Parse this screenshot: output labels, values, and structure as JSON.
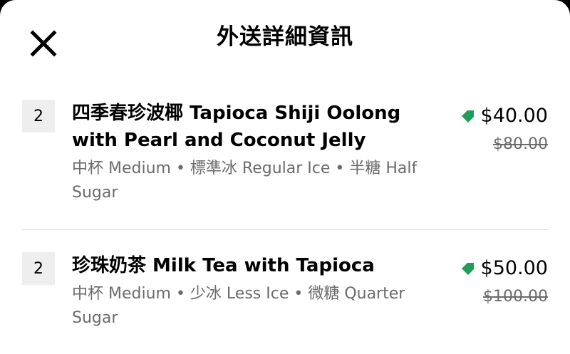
{
  "header": {
    "title": "外送詳細資訊",
    "close_icon": "close-icon"
  },
  "items": [
    {
      "quantity": "2",
      "name": "四季春珍波椰 Tapioca Shiji Oolong with Pearl and Coconut Jelly",
      "options": "中杯 Medium • 標準冰 Regular Ice • 半糖 Half Sugar",
      "price": "$40.00",
      "original_price": "$80.00",
      "promo_icon": "promo-tag-icon"
    },
    {
      "quantity": "2",
      "name": "珍珠奶茶 Milk Tea with Tapioca",
      "options": "中杯 Medium • 少冰 Less Ice • 微糖 Quarter Sugar",
      "price": "$50.00",
      "original_price": "$100.00",
      "promo_icon": "promo-tag-icon"
    }
  ],
  "colors": {
    "promo_green": "#1e9e57",
    "secondary_text": "#6b6b6b",
    "qty_background": "#eeeeee"
  }
}
